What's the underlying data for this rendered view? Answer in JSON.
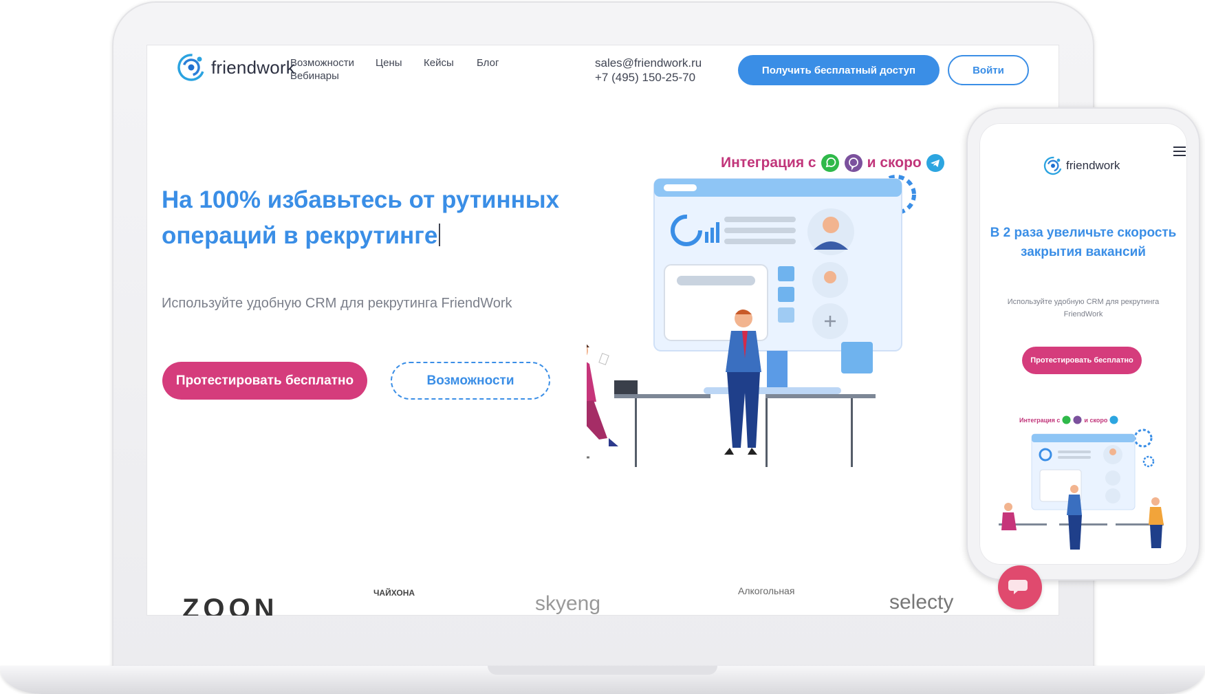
{
  "desktop": {
    "logo_text": "friendwork",
    "nav": {
      "features": "Возможности",
      "prices": "Цены",
      "cases": "Кейсы",
      "blog": "Блог",
      "webinars": "Вебинары"
    },
    "contact": {
      "email": "sales@friendwork.ru",
      "phone": "+7 (495) 150-25-70"
    },
    "buttons": {
      "get_free_access": "Получить бесплатный доступ",
      "login": "Войти",
      "try_free": "Протестировать бесплатно",
      "features": "Возможности"
    },
    "hero": {
      "title_line1": "На 100% избавьтесь от рутинных",
      "title_line2": "операций в рекрутинге",
      "subtitle": "Используйте удобную CRM для рекрутинга FriendWork"
    },
    "integration": {
      "prefix": "Интеграция с",
      "soon": "и скоро",
      "icons": [
        "whatsapp-icon",
        "viber-icon",
        "telegram-icon"
      ]
    },
    "partners": [
      "ZOON",
      "ЧАЙХОНА",
      "skyeng",
      "Алкогольная",
      "selecty"
    ]
  },
  "mobile": {
    "logo_text": "friendwork",
    "title": "В 2 раза увеличьте скорость закрытия вакансий",
    "subtitle": "Используйте удобную CRM для рекрутинга FriendWork",
    "button": "Протестировать бесплатно",
    "integration_prefix": "Интеграция с",
    "integration_soon": "и скоро"
  },
  "colors": {
    "accent_blue": "#3a8ee6",
    "accent_pink": "#d53c7c",
    "integration_text": "#c1357a",
    "whatsapp": "#2fb94a",
    "viber": "#7b519d",
    "telegram": "#2ca5e0"
  }
}
